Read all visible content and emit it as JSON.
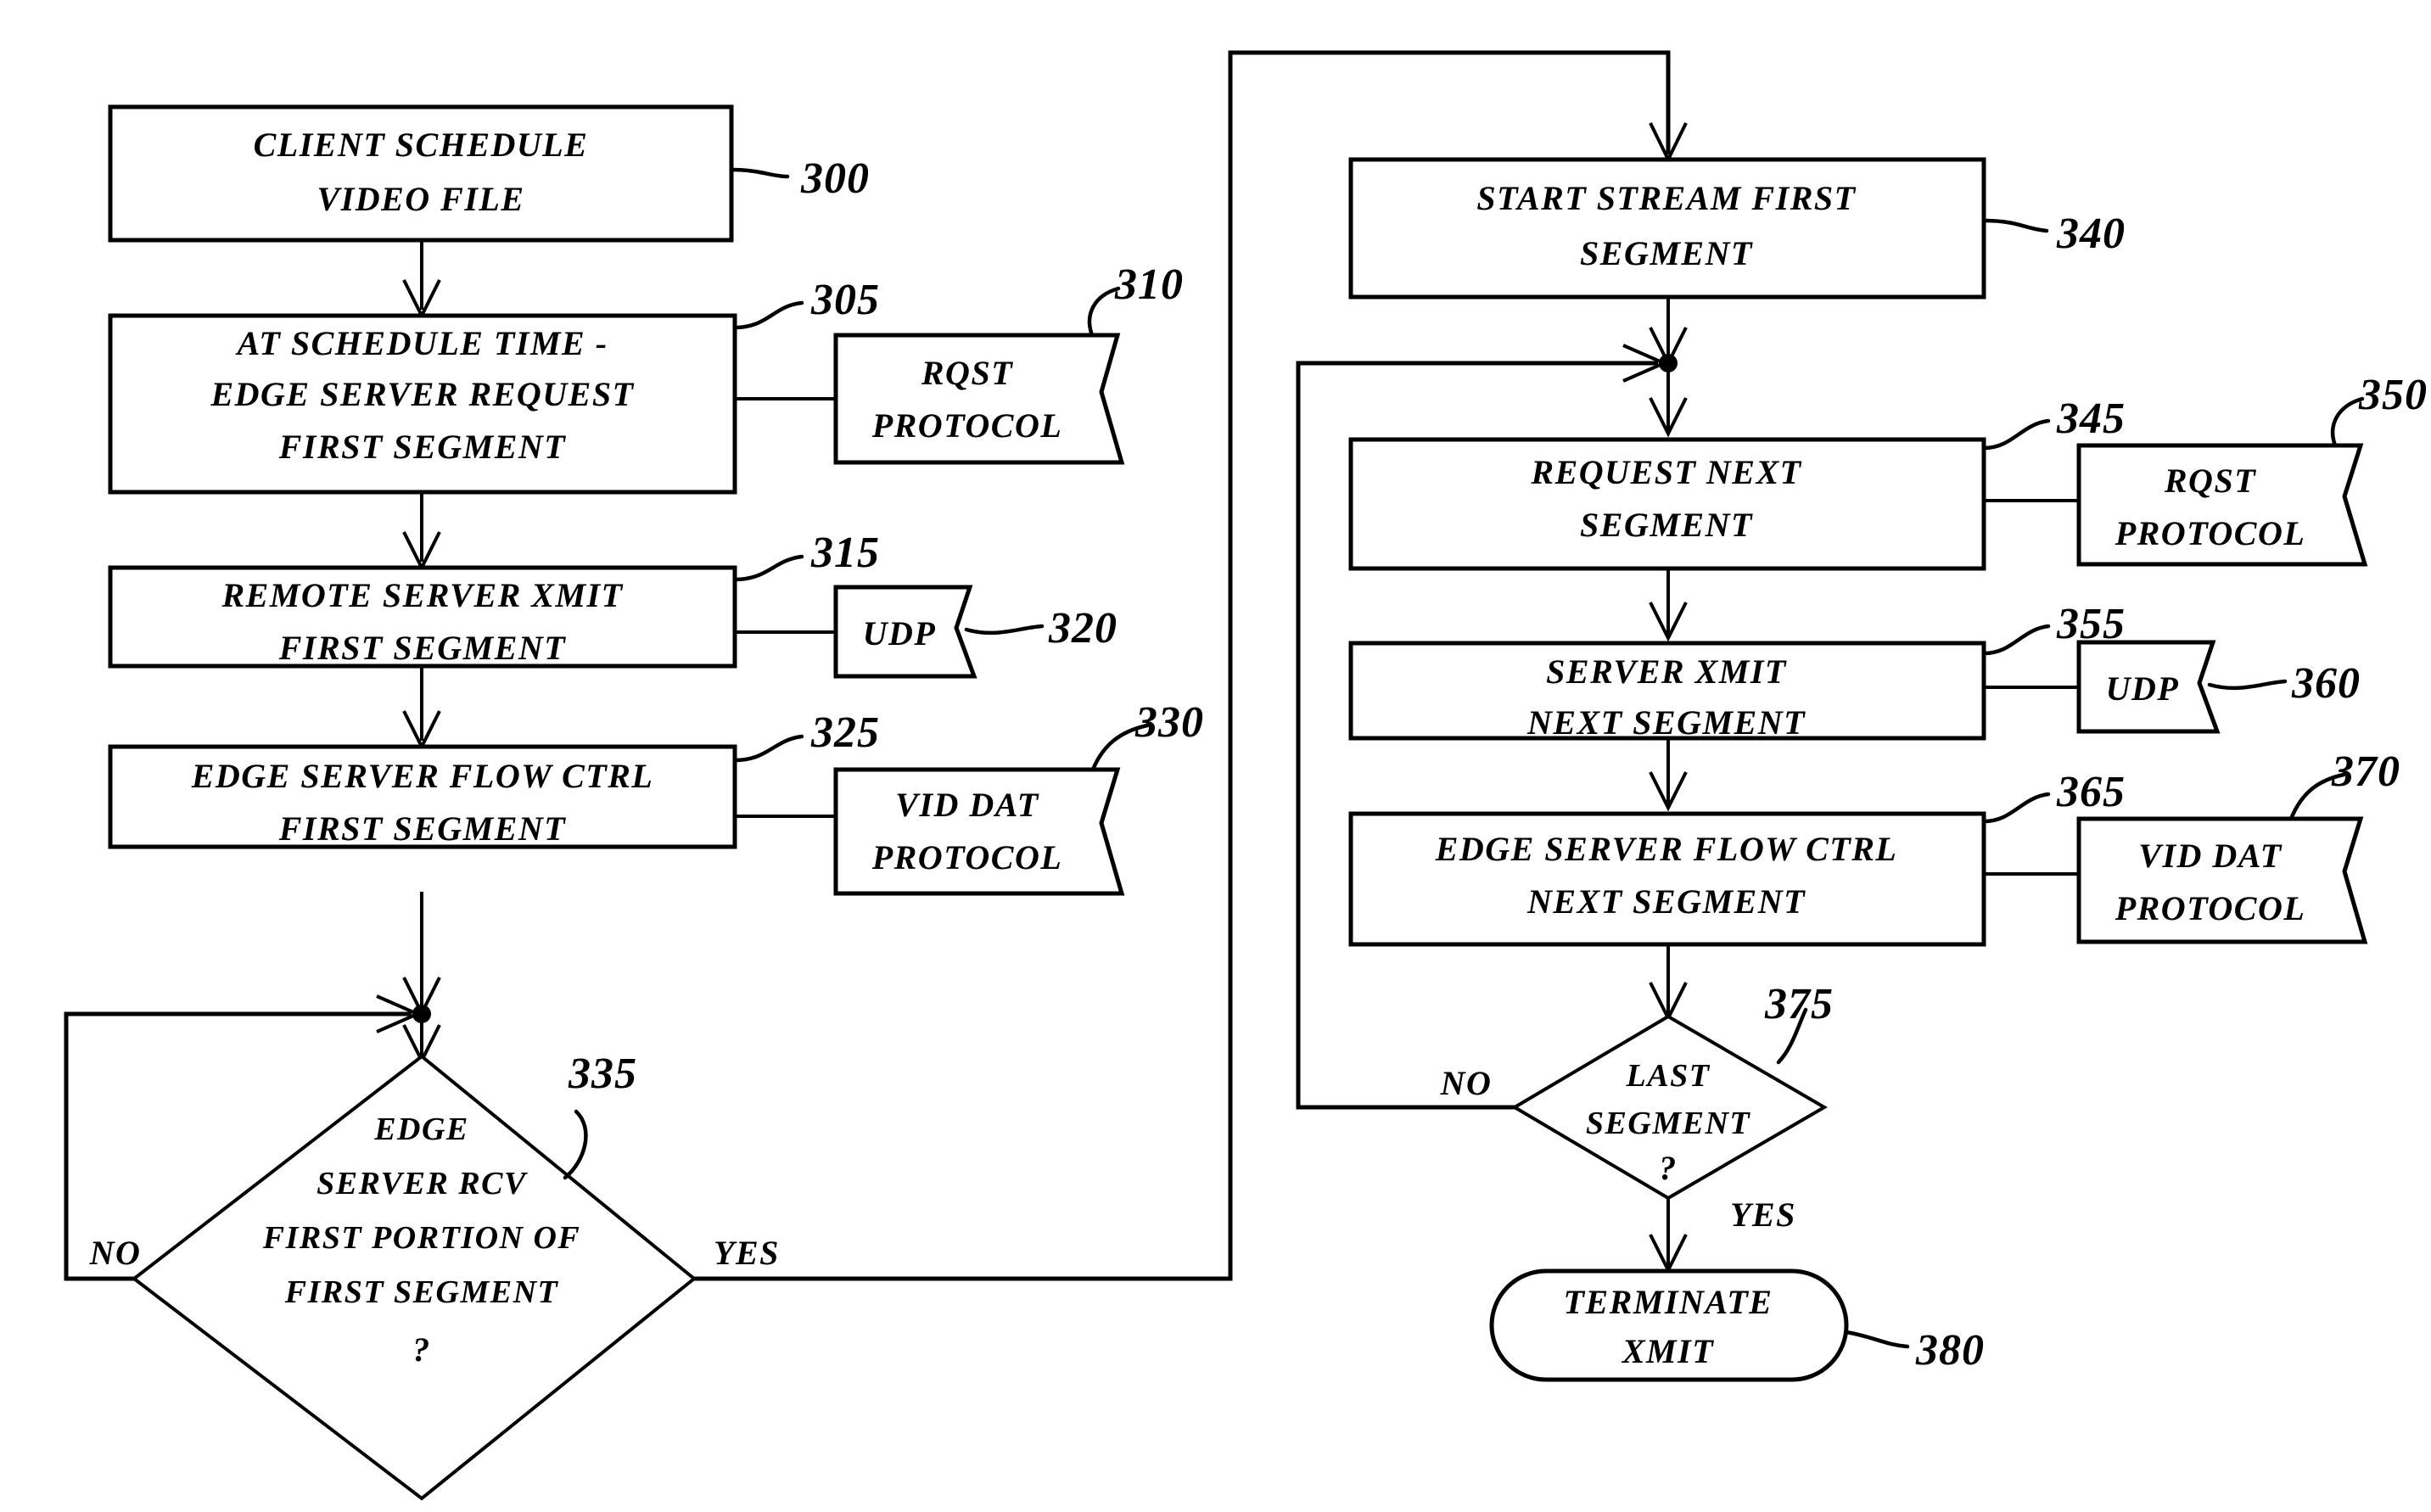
{
  "figure": {
    "type": "patent-flowchart",
    "title": "",
    "background_color": "#ffffff",
    "line_color": "#000000"
  },
  "nodes": {
    "n300": {
      "ref": "300",
      "shape": "process",
      "lines": [
        "CLIENT SCHEDULE",
        "VIDEO FILE"
      ]
    },
    "n305": {
      "ref": "305",
      "shape": "process",
      "lines": [
        "AT SCHEDULE TIME -",
        "EDGE SERVER REQUEST",
        "FIRST SEGMENT"
      ]
    },
    "n310": {
      "ref": "310",
      "shape": "flag",
      "lines": [
        "RQST",
        "PROTOCOL"
      ]
    },
    "n315": {
      "ref": "315",
      "shape": "process",
      "lines": [
        "REMOTE SERVER XMIT",
        "FIRST SEGMENT"
      ]
    },
    "n320": {
      "ref": "320",
      "shape": "flag",
      "lines": [
        "UDP"
      ]
    },
    "n325": {
      "ref": "325",
      "shape": "process",
      "lines": [
        "EDGE SERVER FLOW CTRL",
        "FIRST SEGMENT"
      ]
    },
    "n330": {
      "ref": "330",
      "shape": "flag",
      "lines": [
        "VID DAT",
        "PROTOCOL"
      ]
    },
    "n335": {
      "ref": "335",
      "shape": "decision",
      "lines": [
        "EDGE",
        "SERVER RCV",
        "FIRST PORTION OF",
        "FIRST SEGMENT",
        "?"
      ],
      "branch_no": "NO",
      "branch_yes": "YES"
    },
    "n340": {
      "ref": "340",
      "shape": "process",
      "lines": [
        "START STREAM FIRST",
        "SEGMENT"
      ]
    },
    "n345": {
      "ref": "345",
      "shape": "process",
      "lines": [
        "REQUEST NEXT",
        "SEGMENT"
      ]
    },
    "n350": {
      "ref": "350",
      "shape": "flag",
      "lines": [
        "RQST",
        "PROTOCOL"
      ]
    },
    "n355": {
      "ref": "355",
      "shape": "process",
      "lines": [
        "SERVER XMIT",
        "NEXT SEGMENT"
      ]
    },
    "n360": {
      "ref": "360",
      "shape": "flag",
      "lines": [
        "UDP"
      ]
    },
    "n365": {
      "ref": "365",
      "shape": "process",
      "lines": [
        "EDGE SERVER FLOW CTRL",
        "NEXT SEGMENT"
      ]
    },
    "n370": {
      "ref": "370",
      "shape": "flag",
      "lines": [
        "VID DAT",
        "PROTOCOL"
      ]
    },
    "n375": {
      "ref": "375",
      "shape": "decision",
      "lines": [
        "LAST",
        "SEGMENT",
        "?"
      ],
      "branch_no": "NO",
      "branch_yes": "YES"
    },
    "n380": {
      "ref": "380",
      "shape": "terminator",
      "lines": [
        "TERMINATE",
        "XMIT"
      ]
    }
  },
  "edges": [
    {
      "from": "n300",
      "to": "n305",
      "label": ""
    },
    {
      "from": "n305",
      "to": "n310",
      "label": ""
    },
    {
      "from": "n305",
      "to": "n315",
      "label": ""
    },
    {
      "from": "n315",
      "to": "n320",
      "label": ""
    },
    {
      "from": "n315",
      "to": "n325",
      "label": ""
    },
    {
      "from": "n325",
      "to": "n330",
      "label": ""
    },
    {
      "from": "n325",
      "to": "n335",
      "label": ""
    },
    {
      "from": "n335",
      "to": "n335",
      "label": "NO"
    },
    {
      "from": "n335",
      "to": "n340",
      "label": "YES"
    },
    {
      "from": "n340",
      "to": "n345",
      "label": ""
    },
    {
      "from": "n345",
      "to": "n350",
      "label": ""
    },
    {
      "from": "n345",
      "to": "n355",
      "label": ""
    },
    {
      "from": "n355",
      "to": "n360",
      "label": ""
    },
    {
      "from": "n355",
      "to": "n365",
      "label": ""
    },
    {
      "from": "n365",
      "to": "n370",
      "label": ""
    },
    {
      "from": "n365",
      "to": "n375",
      "label": ""
    },
    {
      "from": "n375",
      "to": "n345",
      "label": "NO"
    },
    {
      "from": "n375",
      "to": "n380",
      "label": "YES"
    }
  ]
}
